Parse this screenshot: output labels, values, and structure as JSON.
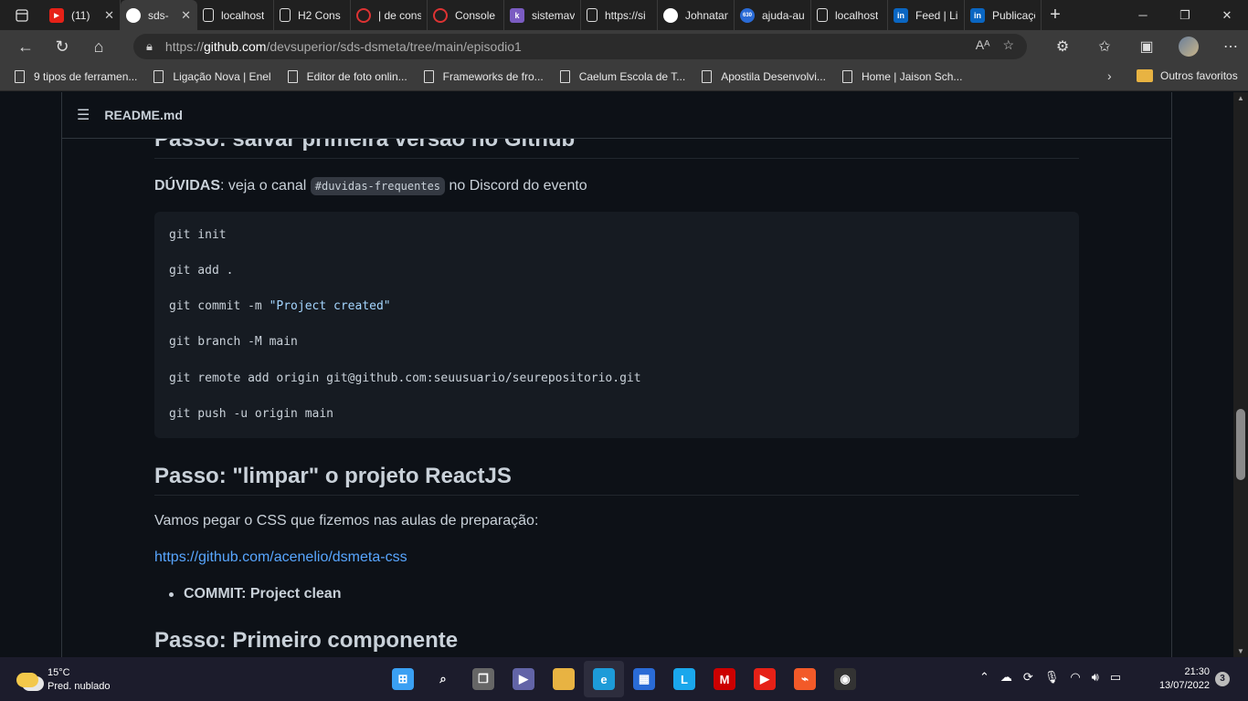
{
  "browser": {
    "tabs": [
      {
        "label": "(11)",
        "icon": "youtube-icon",
        "color": "#e62117"
      },
      {
        "label": "sds-",
        "icon": "github-icon",
        "color": "#ffffff",
        "active": true
      },
      {
        "label": "localhost",
        "icon": "page-icon"
      },
      {
        "label": "H2 Cons",
        "icon": "page-icon"
      },
      {
        "label": "| de cons",
        "icon": "circle-icon",
        "color": "#d33"
      },
      {
        "label": "Console",
        "icon": "circle-icon",
        "color": "#d33"
      },
      {
        "label": "sistemav",
        "icon": "h-icon",
        "color": "#7b5cc2"
      },
      {
        "label": "https://si",
        "icon": "page-icon"
      },
      {
        "label": "Johnatan",
        "icon": "github-icon",
        "color": "#ffffff"
      },
      {
        "label": "ajuda-au",
        "icon": "badge-icon",
        "color": "#2a6bd6",
        "badge": "630"
      },
      {
        "label": "localhost",
        "icon": "page-icon"
      },
      {
        "label": "Feed | Lir",
        "icon": "linkedin-icon",
        "color": "#0a66c2"
      },
      {
        "label": "Publicaçõ",
        "icon": "linkedin-icon",
        "color": "#0a66c2"
      }
    ],
    "close_glyph": "✕",
    "new_tab_glyph": "+",
    "url_prefix": "https://",
    "url_host": "github.com",
    "url_path": "/devsuperior/sds-dsmeta/tree/main/episodio1",
    "bookmarks": [
      "9 tipos de ferramen...",
      "Ligação Nova | Enel",
      "Editor de foto onlin...",
      "Frameworks de fro...",
      "Caelum Escola de T...",
      "Apostila Desenvolvi...",
      "Home | Jaison Sch..."
    ],
    "other_favorites": "Outros favoritos"
  },
  "readme": {
    "title": "README.md",
    "heading1": "Passo: salvar primeira versão no Github",
    "duvidas_label": "DÚVIDAS",
    "duvidas_text": ": veja o canal",
    "duvidas_code": "#duvidas-frequentes",
    "duvidas_tail": "no Discord do evento",
    "code_lines": [
      "git init",
      "git add .",
      "git commit -m ",
      "git branch -M main",
      "git remote add origin git@github.com:seuusuario/seurepositorio.git",
      "git push -u origin main"
    ],
    "commit_message": "\"Project created\"",
    "heading2": "Passo: \"limpar\" o projeto ReactJS",
    "css_text": "Vamos pegar o CSS que fizemos nas aulas de preparação:",
    "css_link": "https://github.com/acenelio/dsmeta-css",
    "bullet": "COMMIT: Project clean",
    "heading3": "Passo: Primeiro componente"
  },
  "taskbar": {
    "temperature": "15°C",
    "weather": "Pred. nublado",
    "time": "21:30",
    "date": "13/07/2022",
    "notifications": "3",
    "apps": [
      {
        "name": "start-icon",
        "color": "#3aa0f3",
        "glyph": "⊞"
      },
      {
        "name": "search-icon",
        "color": "transparent",
        "glyph": "⌕"
      },
      {
        "name": "task-view-icon",
        "color": "#666",
        "glyph": "❐"
      },
      {
        "name": "teams-chat-icon",
        "color": "#6264a7",
        "glyph": "▶"
      },
      {
        "name": "file-explorer-icon",
        "color": "#e8b342",
        "glyph": ""
      },
      {
        "name": "edge-icon",
        "color": "#1d9bd8",
        "glyph": "e",
        "active": true
      },
      {
        "name": "store-icon",
        "color": "#2a6bd6",
        "glyph": "▦"
      },
      {
        "name": "l-app-icon",
        "color": "#1aa7ec",
        "glyph": "L"
      },
      {
        "name": "mcafee-icon",
        "color": "#c00",
        "glyph": "M"
      },
      {
        "name": "youtube-icon",
        "color": "#e62117",
        "glyph": "▶"
      },
      {
        "name": "brave-icon",
        "color": "#f25a29",
        "glyph": "⌁"
      },
      {
        "name": "obs-icon",
        "color": "#333",
        "glyph": "◉"
      }
    ]
  }
}
